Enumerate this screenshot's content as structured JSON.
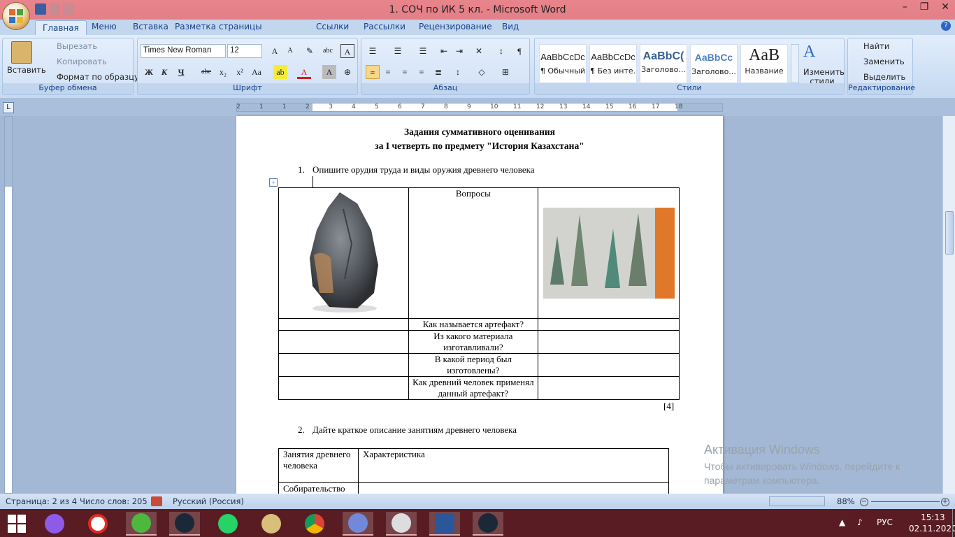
{
  "window": {
    "title": "1. СОЧ по ИК 5 кл. - Microsoft Word",
    "minimize": "–",
    "maximize": "❐",
    "close": "✕"
  },
  "tabs": [
    "Главная",
    "Меню",
    "Вставка",
    "Разметка страницы",
    "Ссылки",
    "Рассылки",
    "Рецензирование",
    "Вид"
  ],
  "help": "?",
  "ribbon": {
    "clipboard": {
      "paste": "Вставить",
      "cut": "Вырезать",
      "copy": "Копировать",
      "format_painter": "Формат по образцу",
      "label": "Буфер обмена"
    },
    "font": {
      "name": "Times New Roman",
      "size": "12",
      "label": "Шрифт",
      "bold": "Ж",
      "italic": "К",
      "underline": "Ч",
      "strike": "abe",
      "subscript": "x₂",
      "superscript": "x²",
      "change_case": "Aa"
    },
    "paragraph": {
      "label": "Абзац"
    },
    "styles": {
      "label": "Стили",
      "items": [
        {
          "preview": "AaBbCcDc",
          "name": "¶ Обычный"
        },
        {
          "preview": "AaBbCcDc",
          "name": "¶ Без инте..."
        },
        {
          "preview": "AaBbC(",
          "name": "Заголово..."
        },
        {
          "preview": "AaBbCc",
          "name": "Заголово..."
        },
        {
          "preview": "AaB",
          "name": "Название"
        }
      ],
      "change": "Изменить стили"
    },
    "editing": {
      "find": "Найти",
      "replace": "Заменить",
      "select": "Выделить",
      "label": "Редактирование"
    }
  },
  "ruler": {
    "marks": [
      "2",
      "1",
      "1",
      "2",
      "3",
      "4",
      "5",
      "6",
      "7",
      "8",
      "9",
      "10",
      "11",
      "12",
      "13",
      "14",
      "15",
      "16",
      "17",
      "18"
    ]
  },
  "document": {
    "title_line1": "Задания суммативного оценивания",
    "title_line2": "за I четверть по предмету \"История Казахстана\"",
    "q1_num": "1.",
    "q1": "Опишите орудия труда и виды оружия древнего человека",
    "table1": {
      "header": "Вопросы",
      "rows": [
        "Как называется артефакт?",
        "Из какого материала изготавливали?",
        "В какой период был изготовлены?",
        "Как древний человек применял данный артефакт?"
      ]
    },
    "score": "[4]",
    "q2_num": "2.",
    "q2": "Дайте краткое описание занятиям древнего человека",
    "table2": {
      "col1": "Занятия древнего человека",
      "col2": "Характеристика",
      "row1": "Собирательство"
    }
  },
  "watermark": {
    "line1": "Активация Windows",
    "line2": "Чтобы активировать Windows, перейдите к параметрам компьютера."
  },
  "status": {
    "page": "Страница: 2 из 4",
    "words": "Число слов: 205",
    "lang": "Русский (Россия)",
    "zoom": "88%"
  },
  "tray": {
    "lang": "РУС",
    "time": "15:13",
    "date": "02.11.2020"
  }
}
